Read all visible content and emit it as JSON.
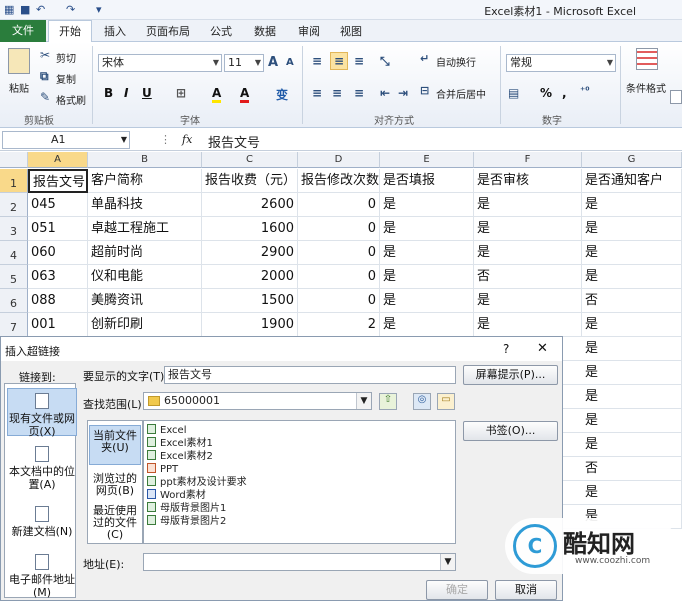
{
  "window": {
    "title": "Excel素材1 - Microsoft Excel",
    "qat_glyphs": [
      "■",
      "↶",
      "↷",
      "▾"
    ]
  },
  "tabs": [
    "文件",
    "开始",
    "插入",
    "页面布局",
    "公式",
    "数据",
    "审阅",
    "视图"
  ],
  "ribbon": {
    "clipboard": {
      "paste": "粘贴",
      "cut": "剪切",
      "copy": "复制",
      "format_painter": "格式刷",
      "group": "剪贴板"
    },
    "font": {
      "family": "宋体",
      "size": "11",
      "group": "字体",
      "grow": "A",
      "shrink": "A",
      "bold": "B",
      "italic": "I",
      "underline": "U",
      "fill_glyph": "A",
      "font_color": "A",
      "wen": "变"
    },
    "alignment": {
      "wrap": "自动换行",
      "merge": "合并后居中",
      "group": "对齐方式"
    },
    "number": {
      "format": "常规",
      "percent": "%",
      "comma": ",",
      "group": "数字"
    },
    "styles": {
      "conditional": "条件格式"
    }
  },
  "formula_bar": {
    "name": "A1",
    "fx": "fx",
    "content": "报告文号"
  },
  "columns": [
    "A",
    "B",
    "C",
    "D",
    "E",
    "F",
    "G"
  ],
  "rows": [
    {
      "n": "1",
      "cells": [
        "报告文号",
        "客户简称",
        "报告收费（元）",
        "报告修改次数",
        "是否填报",
        "是否审核",
        "是否通知客户"
      ]
    },
    {
      "n": "2",
      "cells": [
        "045",
        "单晶科技",
        "2600",
        "0",
        "是",
        "是",
        "是"
      ]
    },
    {
      "n": "3",
      "cells": [
        "051",
        "卓越工程施工",
        "1600",
        "0",
        "是",
        "是",
        "是"
      ]
    },
    {
      "n": "4",
      "cells": [
        "060",
        "超前时尚",
        "2900",
        "0",
        "是",
        "是",
        "是"
      ]
    },
    {
      "n": "5",
      "cells": [
        "063",
        "仪和电能",
        "2000",
        "0",
        "是",
        "否",
        "是"
      ]
    },
    {
      "n": "6",
      "cells": [
        "088",
        "美腾资讯",
        "1500",
        "0",
        "是",
        "是",
        "否"
      ]
    },
    {
      "n": "7",
      "cells": [
        "001",
        "创新印刷",
        "1900",
        "2",
        "是",
        "是",
        "是"
      ]
    }
  ],
  "column_g_below": [
    "是",
    "是",
    "是",
    "是",
    "是",
    "否",
    "是",
    "是"
  ],
  "dialog": {
    "title": "插入超链接",
    "help": "?",
    "close": "✕",
    "link_to": "链接到:",
    "nav": [
      "现有文件或网页(X)",
      "本文档中的位置(A)",
      "新建文档(N)",
      "电子邮件地址(M)"
    ],
    "display_label": "要显示的文字(T):",
    "display_value": "报告文号",
    "screen_tip": "屏幕提示(P)...",
    "lookin_label": "查找范围(L):",
    "lookin_value": "65000001",
    "subnav": [
      "当前文件夹(U)",
      "浏览过的网页(B)",
      "最近使用过的文件(C)"
    ],
    "files": [
      {
        "name": "Excel",
        "kind": "excel"
      },
      {
        "name": "Excel素材1",
        "kind": "excel"
      },
      {
        "name": "Excel素材2",
        "kind": "excel"
      },
      {
        "name": "PPT",
        "kind": "ppt"
      },
      {
        "name": "ppt素材及设计要求",
        "kind": "excel"
      },
      {
        "name": "Word素材",
        "kind": "word"
      },
      {
        "name": "母版背景图片1",
        "kind": "excel"
      },
      {
        "name": "母版背景图片2",
        "kind": "excel"
      }
    ],
    "bookmark": "书签(O)...",
    "address_label": "地址(E):",
    "ok": "确定",
    "cancel": "取消"
  },
  "watermark": {
    "name": "酷知网",
    "url": "www.coozhi.com",
    "logo": "C"
  },
  "colors": {
    "file_tab": "#2a7d3c",
    "selected_header": "#f9d98a",
    "nav_selected": "#c7dcf3"
  }
}
